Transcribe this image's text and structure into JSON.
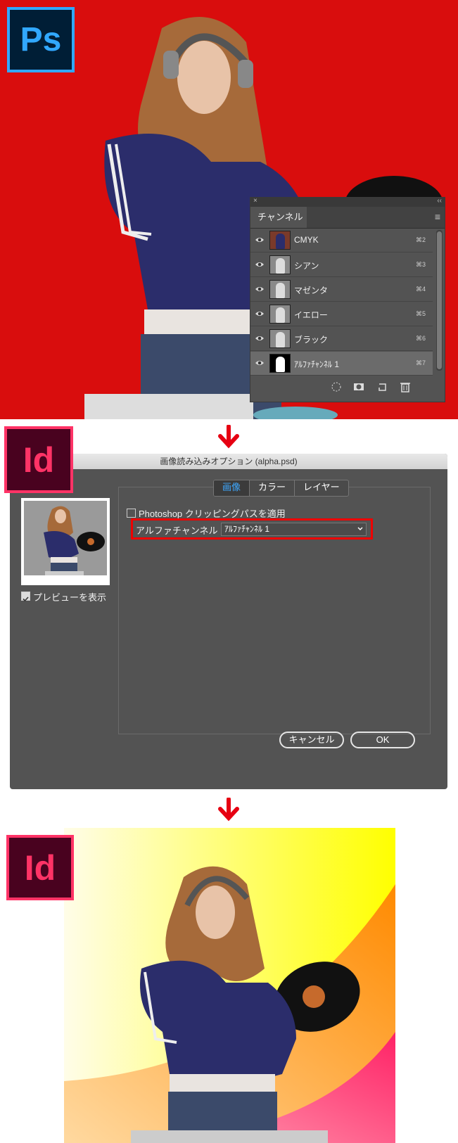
{
  "photoshop": {
    "logo": "Ps",
    "channels_panel": {
      "close_glyph": "×",
      "collapse_glyph": "‹‹",
      "tab": "チャンネル",
      "menu_icon": "panel-menu-icon",
      "rows": [
        {
          "name": "CMYK",
          "shortcut": "⌘2"
        },
        {
          "name": "シアン",
          "shortcut": "⌘3"
        },
        {
          "name": "マゼンタ",
          "shortcut": "⌘4"
        },
        {
          "name": "イエロー",
          "shortcut": "⌘5"
        },
        {
          "name": "ブラック",
          "shortcut": "⌘6"
        },
        {
          "name": "ｱﾙﾌｧﾁｬﾝﾈﾙ 1",
          "shortcut": "⌘7"
        }
      ],
      "selected_row": 5,
      "bottom_icons": [
        "load-selection-icon",
        "save-selection-icon",
        "new-channel-icon",
        "trash-icon"
      ]
    }
  },
  "indesign_dialog": {
    "logo": "Id",
    "title": "画像読み込みオプション (alpha.psd)",
    "tabs": [
      "画像",
      "カラー",
      "レイヤー"
    ],
    "active_tab": "画像",
    "clipping_path_label": "Photoshop クリッピングパスを適用",
    "clipping_path_checked": false,
    "alpha_label": "アルファチャンネル :",
    "alpha_value": "ｱﾙﾌｧﾁｬﾝﾈﾙ 1",
    "preview_label": "プレビューを表示",
    "preview_checked": true,
    "cancel_label": "キャンセル",
    "ok_label": "OK"
  },
  "result": {
    "logo": "Id"
  },
  "colors": {
    "ps_red": "#d90d0d",
    "ps_blue": "#31a8ff",
    "id_pink": "#ff3366",
    "arrow_red": "#e60012",
    "highlight_red": "#ee0000"
  }
}
